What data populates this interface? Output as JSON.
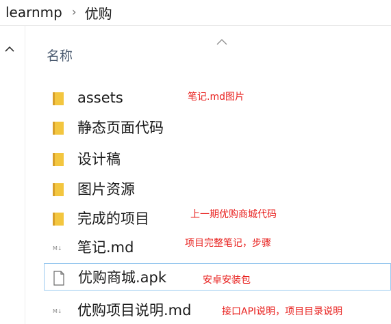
{
  "breadcrumb": {
    "root": "learnmp",
    "current": "优购"
  },
  "column_header": {
    "name": "名称"
  },
  "files": [
    {
      "name": "assets",
      "type": "folder"
    },
    {
      "name": "静态页面代码",
      "type": "folder"
    },
    {
      "name": "设计稿",
      "type": "folder"
    },
    {
      "name": "图片资源",
      "type": "folder"
    },
    {
      "name": "完成的项目",
      "type": "folder"
    },
    {
      "name": "笔记.md",
      "type": "markdown"
    },
    {
      "name": "优购商城.apk",
      "type": "file"
    },
    {
      "name": "优购项目说明.md",
      "type": "markdown"
    }
  ],
  "annotations": {
    "assets": "笔记.md图片",
    "finished_project": "上一期优购商城代码",
    "notes": "项目完整笔记，步骤",
    "apk": "安卓安装包",
    "readme": "接口API说明，项目目录说明"
  },
  "colors": {
    "annotation": "#e8201e",
    "folder": "#f1c232",
    "selection_border": "#99c9ef"
  }
}
